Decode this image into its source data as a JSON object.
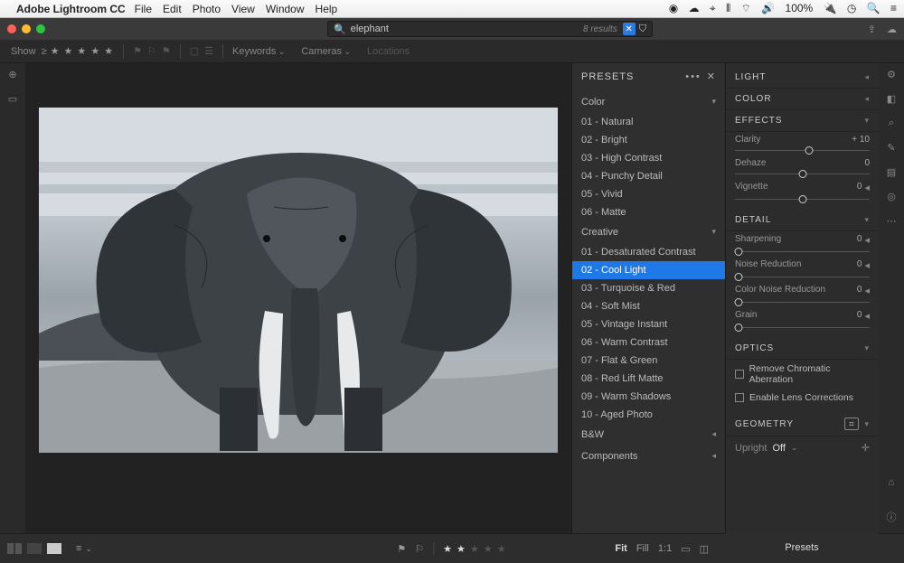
{
  "menubar": {
    "app": "Adobe Lightroom CC",
    "items": [
      "File",
      "Edit",
      "Photo",
      "View",
      "Window",
      "Help"
    ],
    "battery": "100%"
  },
  "search": {
    "value": "elephant",
    "results": "8 results"
  },
  "filterbar": {
    "show": "Show",
    "keywords": "Keywords",
    "cameras": "Cameras",
    "locations": "Locations"
  },
  "presets": {
    "title": "PRESETS",
    "groups": {
      "color": {
        "label": "Color",
        "items": [
          "01 - Natural",
          "02 - Bright",
          "03 - High Contrast",
          "04 - Punchy Detail",
          "05 - Vivid",
          "06 - Matte"
        ]
      },
      "creative": {
        "label": "Creative",
        "items": [
          "01 - Desaturated Contrast",
          "02 - Cool Light",
          "03 - Turquoise & Red",
          "04 - Soft Mist",
          "05 - Vintage Instant",
          "06 - Warm Contrast",
          "07 - Flat & Green",
          "08 - Red Lift Matte",
          "09 - Warm Shadows",
          "10 - Aged Photo"
        ],
        "selected": 1
      },
      "bw": {
        "label": "B&W"
      },
      "components": {
        "label": "Components"
      }
    }
  },
  "edit": {
    "light": "LIGHT",
    "color": "COLOR",
    "effects": {
      "title": "EFFECTS",
      "clarity": {
        "label": "Clarity",
        "value": "+ 10",
        "pos": 55
      },
      "dehaze": {
        "label": "Dehaze",
        "value": "0",
        "pos": 50
      },
      "vignette": {
        "label": "Vignette",
        "value": "0",
        "pos": 50
      }
    },
    "detail": {
      "title": "DETAIL",
      "sharpening": {
        "label": "Sharpening",
        "value": "0",
        "pos": 3
      },
      "noise": {
        "label": "Noise Reduction",
        "value": "0",
        "pos": 3
      },
      "colornoise": {
        "label": "Color Noise Reduction",
        "value": "0",
        "pos": 3
      },
      "grain": {
        "label": "Grain",
        "value": "0",
        "pos": 3
      }
    },
    "optics": {
      "title": "OPTICS",
      "chroma": "Remove Chromatic Aberration",
      "lens": "Enable Lens Corrections"
    },
    "geometry": {
      "title": "GEOMETRY",
      "upright": "Upright",
      "off": "Off"
    },
    "footer": "Presets"
  },
  "bottom": {
    "fit": "Fit",
    "fill": "Fill",
    "ratio": "1:1"
  }
}
